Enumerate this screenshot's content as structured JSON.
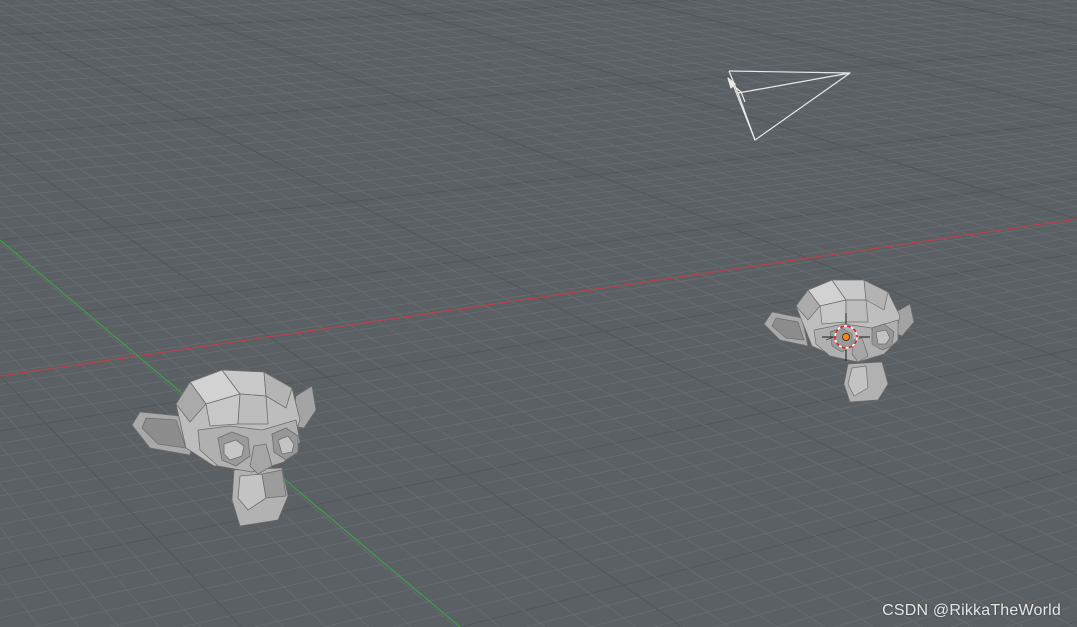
{
  "scene": {
    "background_color": "#5b6064",
    "grid_minor_color": "#676c70",
    "grid_major_color": "#53575a",
    "x_axis_color": "#b0454d",
    "y_axis_color": "#3f9a47",
    "objects": [
      {
        "name": "Suzanne",
        "type": "mesh",
        "icon": "monkey-head-icon"
      },
      {
        "name": "Suzanne.001",
        "type": "mesh",
        "icon": "monkey-head-icon",
        "selected": true
      },
      {
        "name": "Camera",
        "type": "camera",
        "icon": "camera-wireframe-icon"
      }
    ],
    "cursor": {
      "icon": "3d-cursor-icon",
      "origin_color": "#f08a1e"
    }
  },
  "watermark": "CSDN @RikkaTheWorld"
}
